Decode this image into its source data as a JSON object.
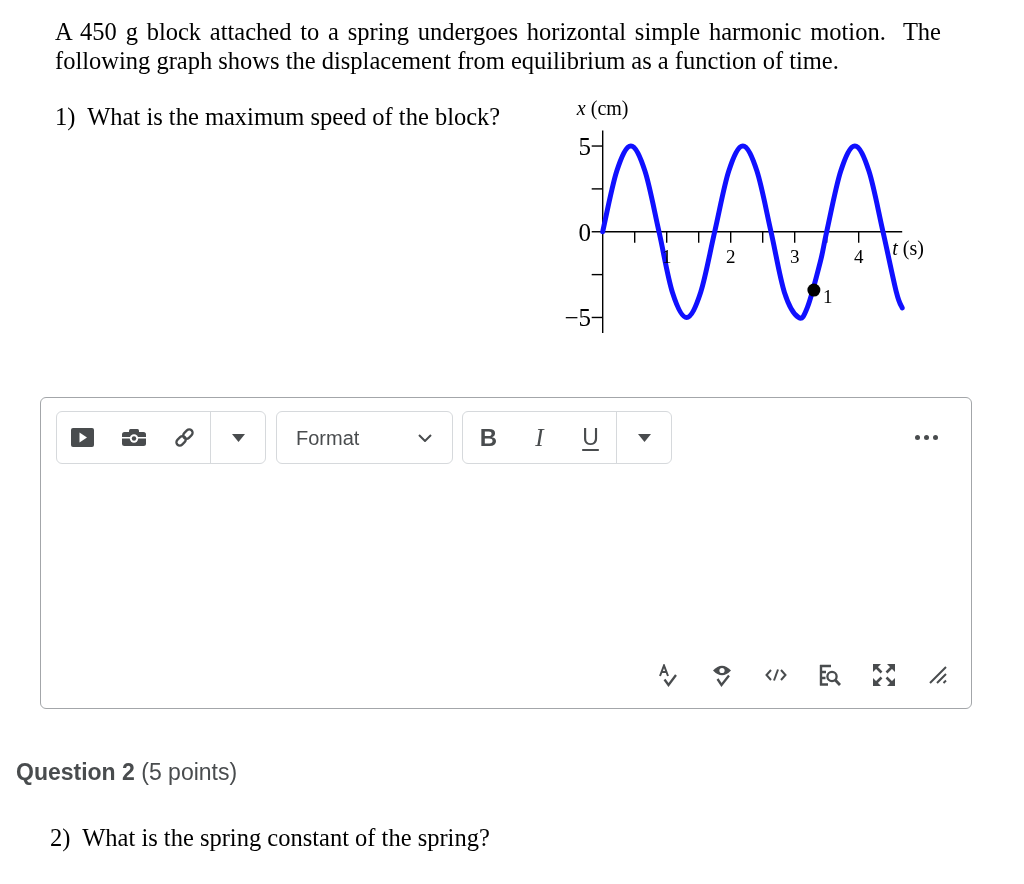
{
  "problem": {
    "text": "A 450 g block attached to a spring undergoes horizontal simple harmonic motion.  The following graph shows the displacement from equilibrium as a function of time."
  },
  "question_1": {
    "prompt": "1)  What is the maximum speed of the block?",
    "graph": {
      "chart_data": {
        "type": "line",
        "xlabel": "*t* (s)",
        "ylabel": "*x* (cm)",
        "x": [
          0,
          0.22,
          0.44,
          0.66,
          0.88,
          1.09,
          1.31,
          1.53,
          1.75,
          1.97,
          2.19,
          2.41,
          2.63,
          2.84,
          3.06,
          3.2,
          3.4,
          3.5,
          3.72,
          3.94,
          4.16,
          4.38,
          4.59,
          4.68
        ],
        "series": [
          {
            "color": "#1010ff",
            "values": [
              0,
              3.54,
              5,
              3.54,
              0,
              -3.54,
              -5,
              -3.54,
              0,
              3.54,
              5,
              3.54,
              0,
              -3.54,
              -5,
              -4.4,
              -1.76,
              0,
              3.54,
              5,
              3.54,
              0,
              -3.54,
              -4.44
            ]
          }
        ],
        "xlim": [
          0,
          4.68
        ],
        "ylim": [
          -5.9,
          5.9
        ],
        "xticks": [
          1,
          2,
          3,
          4
        ],
        "yticks": [
          {
            "value": -5,
            "label": "−5"
          },
          0,
          5
        ],
        "annotations": [
          {
            "x": 3.3,
            "y": -3.4,
            "text": "1"
          }
        ]
      }
    }
  },
  "answer_editor": {
    "format_dropdown": {
      "label": "Format"
    },
    "text_style_buttons": [
      {
        "label": "B",
        "kind": "bold"
      },
      {
        "label": "I",
        "kind": "italic"
      },
      {
        "label": "U",
        "kind": "underline"
      }
    ]
  },
  "question_2": {
    "heading": "**Question 2** (5 points)",
    "prompt": "2)  What is the spring constant of the spring?"
  }
}
